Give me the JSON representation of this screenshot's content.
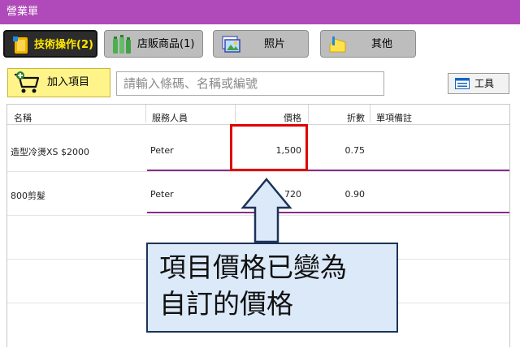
{
  "window": {
    "title": "營業單"
  },
  "tabs": [
    {
      "label": "技術操作(2)",
      "active": true,
      "icon": "service-icon"
    },
    {
      "label": "店販商品(1)",
      "active": false,
      "icon": "bottles-icon"
    },
    {
      "label": "照片",
      "active": false,
      "icon": "photos-icon"
    },
    {
      "label": "其他",
      "active": false,
      "icon": "other-icon"
    }
  ],
  "toolbar": {
    "add_label": "加入項目",
    "search_placeholder": "請輸入條碼、名稱或編號",
    "tool_label": "工具"
  },
  "table": {
    "headers": [
      "名稱",
      "服務人員",
      "價格",
      "折數",
      "單項備註"
    ],
    "rows": [
      {
        "name": "造型冷燙XS $2000",
        "staff": "Peter",
        "price": "1,500",
        "discount": "0.75",
        "note": ""
      },
      {
        "name": "800剪髮",
        "staff": "Peter",
        "price": "720",
        "discount": "0.90",
        "note": ""
      }
    ]
  },
  "annotation": {
    "line1": "項目價格已變為",
    "line2": "自訂的價格"
  },
  "colors": {
    "titlebar": "#b04aba",
    "active_tab_text": "#ffe600",
    "add_button": "#fff48a",
    "highlight": "#e00000",
    "callout_bg": "#dce9f8"
  }
}
